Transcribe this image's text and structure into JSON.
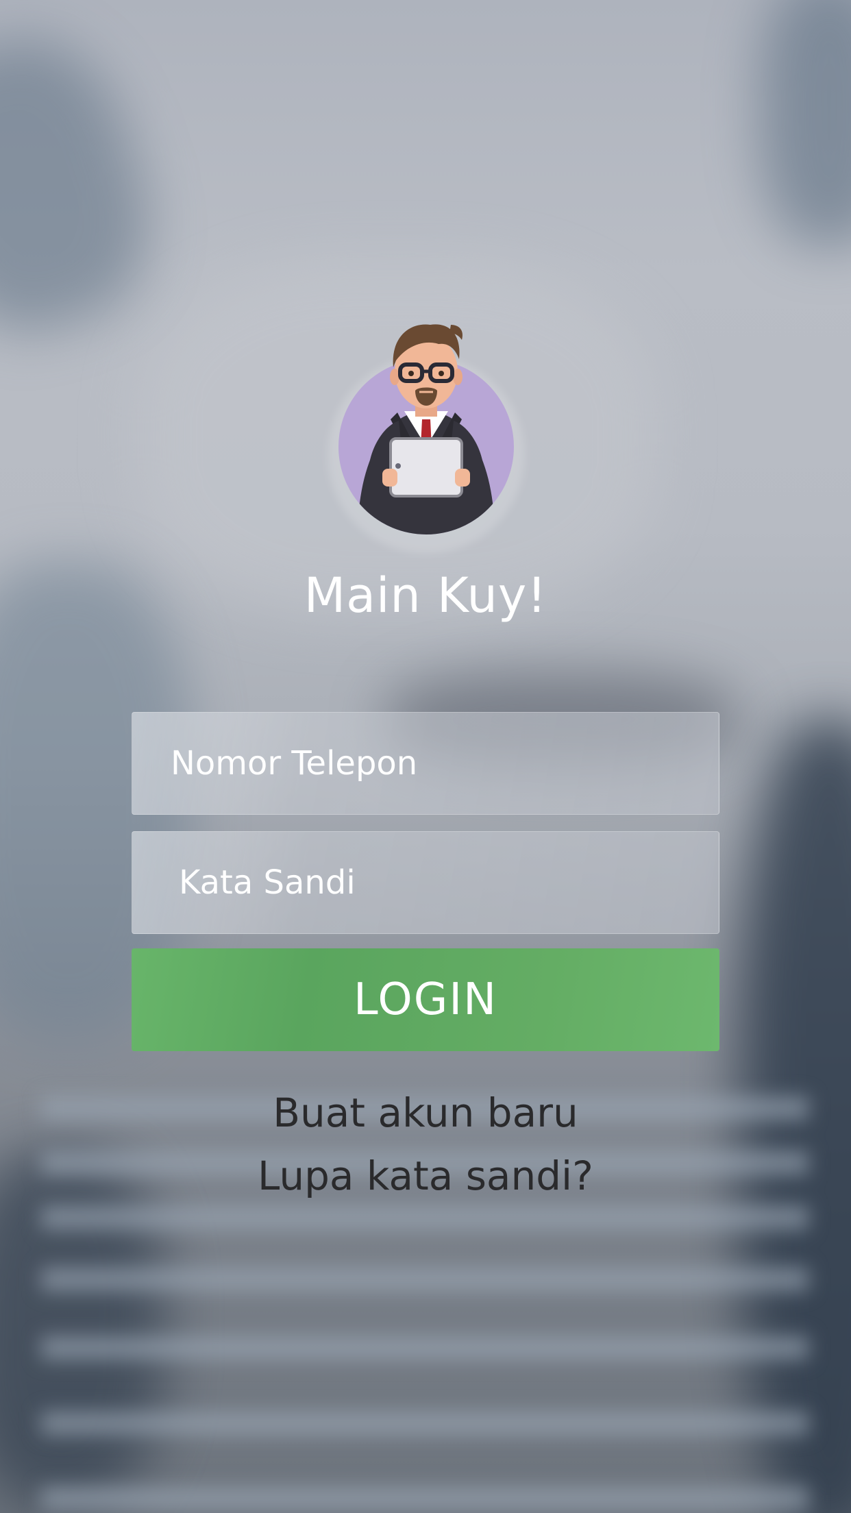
{
  "app": {
    "title": "Main Kuy!"
  },
  "avatar": {
    "icon": "businessman-with-tablet-icon",
    "circle_color": "#b8a6d6"
  },
  "form": {
    "phone_placeholder": "Nomor Telepon",
    "password_placeholder": "Kata Sandi",
    "login_label": "LOGIN",
    "login_color": "#5fa961"
  },
  "links": {
    "register": "Buat akun baru",
    "forgot_password": "Lupa kata sandi?"
  }
}
